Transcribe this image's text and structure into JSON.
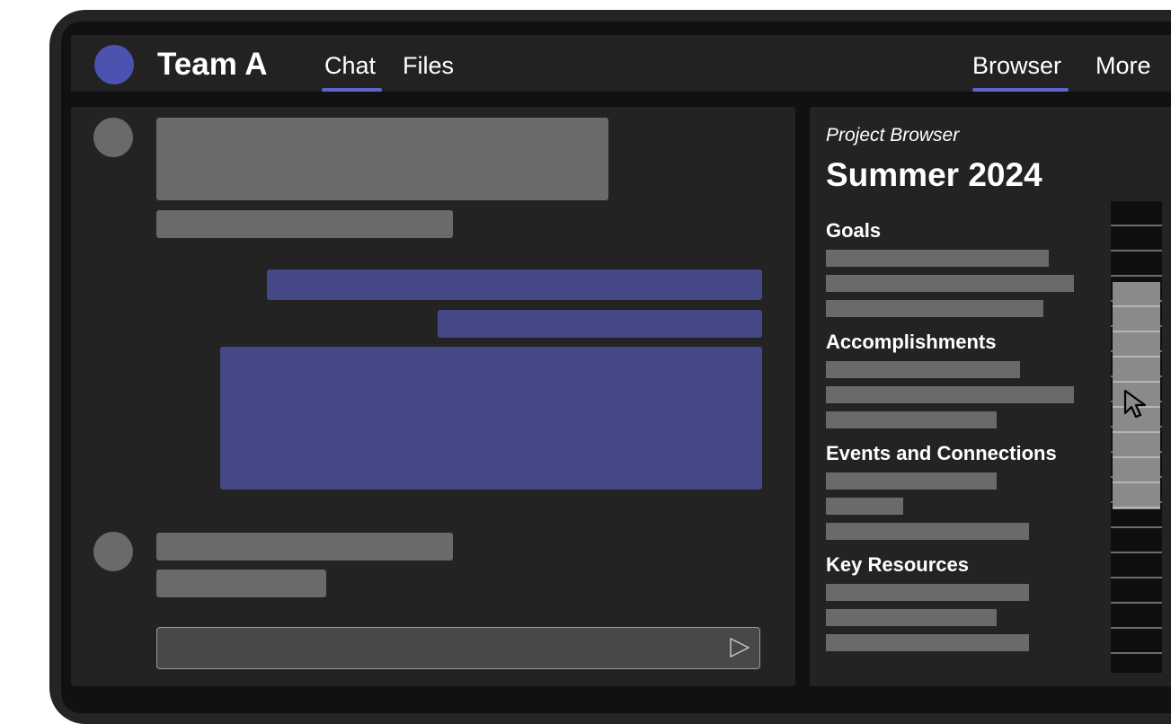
{
  "header": {
    "team_name": "Team A",
    "tabs": [
      {
        "label": "Chat",
        "active": true
      },
      {
        "label": "Files",
        "active": false
      },
      {
        "label": "Browser",
        "active": true
      },
      {
        "label": "More",
        "active": false
      }
    ]
  },
  "browser": {
    "subtitle": "Project Browser",
    "title": "Summer 2024",
    "sections": [
      {
        "heading": "Goals"
      },
      {
        "heading": "Accomplishments"
      },
      {
        "heading": "Events and Connections"
      },
      {
        "heading": "Key Resources"
      }
    ]
  },
  "colors": {
    "accent": "#5f64c8",
    "own_message": "#444886",
    "placeholder": "#6a6a6a",
    "panel": "#232323"
  },
  "icons": {
    "send": "send-icon",
    "cursor": "mouse-cursor-icon"
  }
}
